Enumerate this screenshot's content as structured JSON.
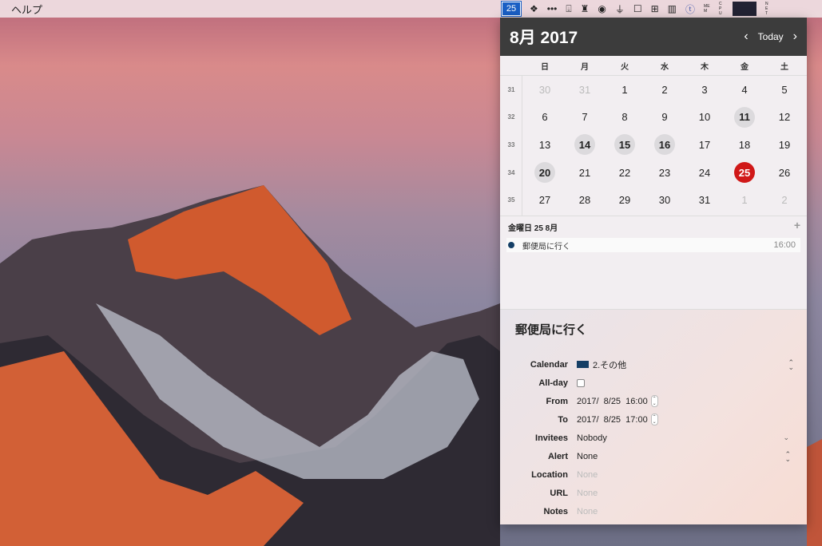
{
  "menubar": {
    "help": "ヘルプ",
    "calendar_day": "25",
    "mem": "MEM",
    "cpu": "CPU",
    "net": "NET"
  },
  "calendar": {
    "title": "8月 2017",
    "today": "Today",
    "prev": "‹",
    "next": "›",
    "weekdays": [
      "日",
      "月",
      "火",
      "水",
      "木",
      "金",
      "土"
    ],
    "weeks": [
      {
        "n": "31",
        "days": [
          [
            "30",
            "dim"
          ],
          [
            "31",
            "dim"
          ],
          [
            "1",
            ""
          ],
          [
            "2",
            ""
          ],
          [
            "3",
            ""
          ],
          [
            "4",
            ""
          ],
          [
            "5",
            ""
          ]
        ]
      },
      {
        "n": "32",
        "days": [
          [
            "6",
            ""
          ],
          [
            "7",
            ""
          ],
          [
            "8",
            ""
          ],
          [
            "9",
            ""
          ],
          [
            "10",
            ""
          ],
          [
            "11",
            "bold"
          ],
          [
            "12",
            ""
          ]
        ]
      },
      {
        "n": "33",
        "days": [
          [
            "13",
            ""
          ],
          [
            "14",
            "bold"
          ],
          [
            "15",
            "bold"
          ],
          [
            "16",
            "bold"
          ],
          [
            "17",
            ""
          ],
          [
            "18",
            ""
          ],
          [
            "19",
            ""
          ]
        ]
      },
      {
        "n": "34",
        "days": [
          [
            "20",
            "bold"
          ],
          [
            "21",
            ""
          ],
          [
            "22",
            ""
          ],
          [
            "23",
            ""
          ],
          [
            "24",
            ""
          ],
          [
            "25",
            "today"
          ],
          [
            "26",
            ""
          ]
        ]
      },
      {
        "n": "35",
        "days": [
          [
            "27",
            ""
          ],
          [
            "28",
            ""
          ],
          [
            "29",
            ""
          ],
          [
            "30",
            ""
          ],
          [
            "31",
            ""
          ],
          [
            "1",
            "dim"
          ],
          [
            "2",
            "dim"
          ]
        ]
      }
    ]
  },
  "events": {
    "date": "金曜日 25 8月",
    "add": "+",
    "items": [
      {
        "title": "郵便局に行く",
        "time": "16:00",
        "color": "#153f66"
      }
    ]
  },
  "detail": {
    "title": "郵便局に行く",
    "calendar_label": "Calendar",
    "calendar_value": "2.その他",
    "allday_label": "All-day",
    "from_label": "From",
    "from_value": "2017/  8/25  16:00",
    "to_label": "To",
    "to_value": "2017/  8/25  17:00",
    "invitees_label": "Invitees",
    "invitees_value": "Nobody",
    "alert_label": "Alert",
    "alert_value": "None",
    "location_label": "Location",
    "location_value": "None",
    "url_label": "URL",
    "url_value": "None",
    "notes_label": "Notes",
    "notes_value": "None"
  }
}
